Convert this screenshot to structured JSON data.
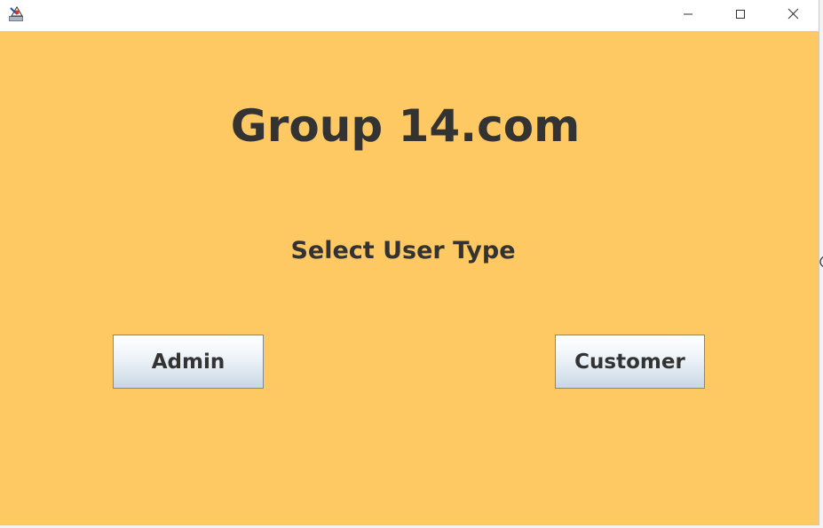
{
  "window": {
    "icon": "java-app-icon",
    "controls": {
      "minimize_icon": "minimize-icon",
      "maximize_icon": "maximize-icon",
      "close_icon": "close-icon"
    }
  },
  "main": {
    "title": "Group 14.com",
    "subtitle": "Select User Type",
    "background_color": "#fec862",
    "buttons": {
      "admin_label": "Admin",
      "customer_label": "Customer"
    }
  }
}
